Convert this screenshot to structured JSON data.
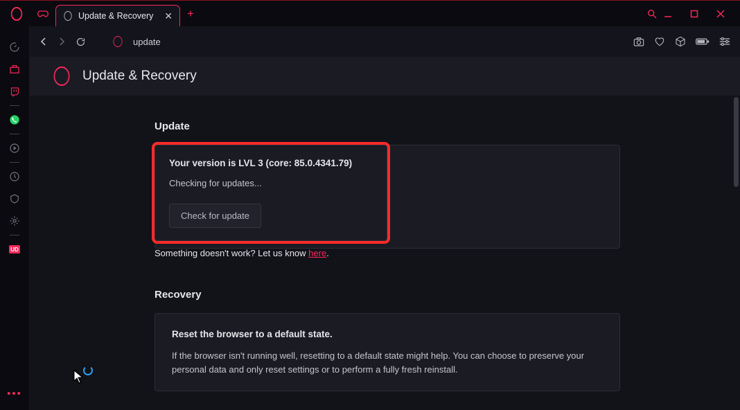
{
  "window": {
    "tab_title": "Update & Recovery"
  },
  "addressbar": {
    "url_text": "update"
  },
  "page": {
    "heading": "Update & Recovery",
    "update": {
      "section_title": "Update",
      "version_line": "Your version is  LVL 3 (core: 85.0.4341.79)",
      "status": "Checking for updates...",
      "button": "Check for update",
      "feedback_prefix": "Something doesn't work? Let us know ",
      "feedback_link": "here",
      "feedback_suffix": "."
    },
    "recovery": {
      "section_title": "Recovery",
      "line1": "Reset the browser to a default state.",
      "line2": "If the browser isn't running well, resetting to a default state might help. You can choose to preserve your personal data and only reset settings or to perform a fully fresh reinstall."
    }
  },
  "sidebar_badge": "UD"
}
